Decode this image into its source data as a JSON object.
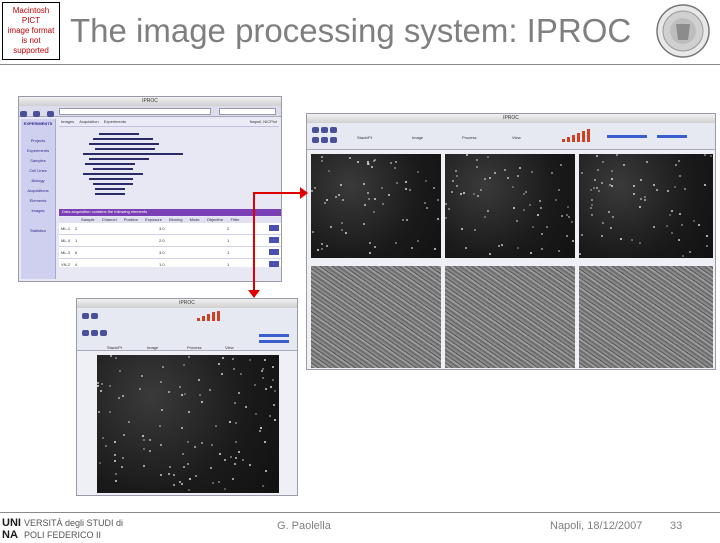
{
  "header": {
    "pict_placeholder": "Macintosh PICT\nimage format\nis not supported",
    "title": "The image processing system: IPROC",
    "seal_icon": "university-seal-icon"
  },
  "windows": {
    "main": {
      "title": "IPROC",
      "menu": [
        "Images",
        "Acquisition",
        "Experiments"
      ],
      "user": "Napoli, NICPlot",
      "sidebar": [
        "EXPERIMENTS",
        "Projects",
        "Experiments",
        "Samples",
        "Cell Lines",
        "Biology",
        "Acquisitions",
        "Elements",
        "Images",
        "Statistics"
      ],
      "section_header": "Data acquisition contains the following elements",
      "table_headers": [
        "Sample",
        "Channel",
        "Position",
        "Exposure",
        "Binning",
        "Mode",
        "Objective",
        "Filter"
      ],
      "rows": [
        [
          "ML-1",
          "2",
          "3.0",
          "2"
        ],
        [
          "ML-4",
          "1",
          "2.0",
          "1"
        ],
        [
          "ML-3",
          "6",
          "3.0",
          "1"
        ],
        [
          "VN-2",
          "4",
          "1.0",
          "1"
        ]
      ]
    },
    "grid": {
      "title": "IPROC",
      "controls": [
        "Stack/Pt",
        "Image",
        "Process",
        "View"
      ]
    },
    "viewer": {
      "title": "IPROC",
      "controls": [
        "Stack/Pt",
        "Image",
        "Process",
        "View"
      ]
    }
  },
  "colors": {
    "accent": "#7b3fb5",
    "arrow": "#e00000",
    "title": "#7f7f7f"
  },
  "footer": {
    "logo_text": "UNI VERSITÀ degli STUDI di NA POLI FEDERICO II",
    "author": "G. Paolella",
    "date": "Napoli, 18/12/2007",
    "page": "33"
  }
}
